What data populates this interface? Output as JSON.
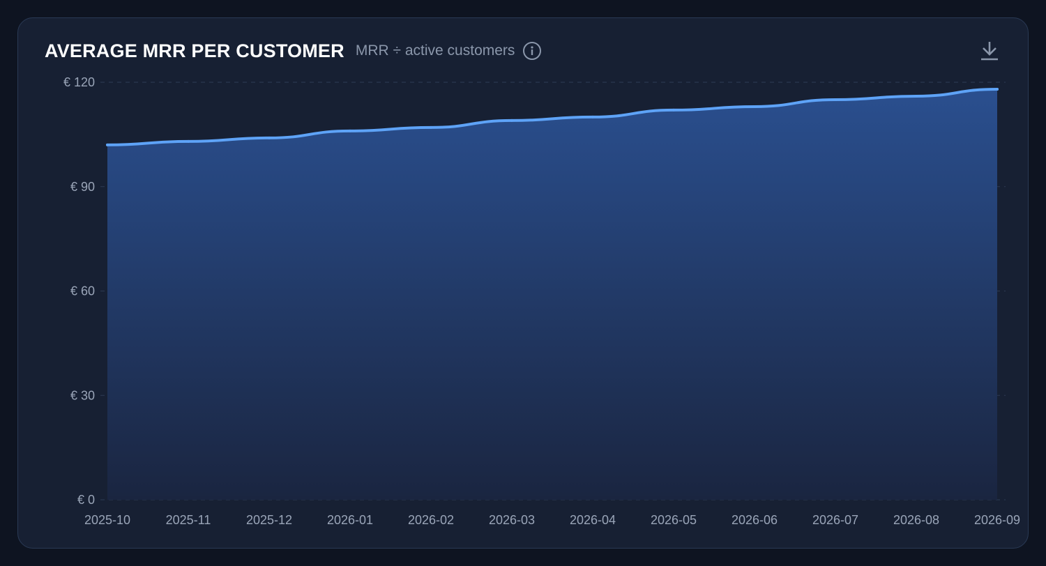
{
  "header": {
    "title": "AVERAGE MRR PER CUSTOMER",
    "subtitle": "MRR ÷ active customers",
    "info_icon": "info-circle-icon",
    "download_icon": "download-icon"
  },
  "colors": {
    "line": "#5ea3f7",
    "area_top": "#2a4f8f",
    "area_bottom": "#1a2540",
    "grid": "#2e3b54",
    "card_bg": "#172033"
  },
  "chart_data": {
    "type": "area",
    "title": "AVERAGE MRR PER CUSTOMER",
    "subtitle": "MRR ÷ active customers",
    "x": [
      "2025-10",
      "2025-11",
      "2025-12",
      "2026-01",
      "2026-02",
      "2026-03",
      "2026-04",
      "2026-05",
      "2026-06",
      "2026-07",
      "2026-08",
      "2026-09"
    ],
    "series": [
      {
        "values": [
          102,
          103,
          104,
          106,
          107,
          109,
          110,
          112,
          113,
          115,
          116,
          118
        ]
      }
    ],
    "ylim": [
      0,
      120
    ],
    "yticks": [
      0,
      30,
      60,
      90,
      120
    ],
    "ytick_labels": [
      "€ 0",
      "€ 30",
      "€ 60",
      "€ 90",
      "€ 120"
    ],
    "grid": true,
    "grid_style": "dashed horizontal",
    "legend": "none"
  }
}
